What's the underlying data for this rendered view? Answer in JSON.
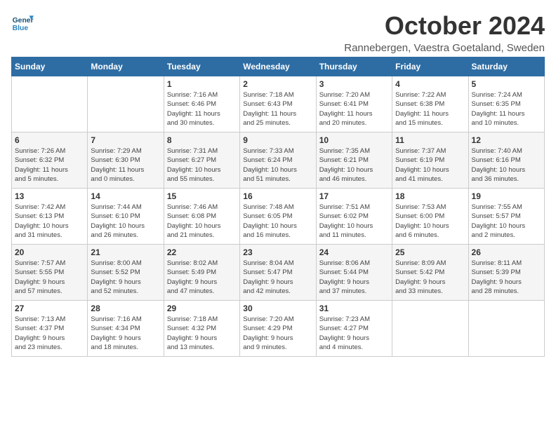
{
  "logo": {
    "general": "General",
    "blue": "Blue"
  },
  "title": "October 2024",
  "location": "Rannebergen, Vaestra Goetaland, Sweden",
  "days_header": [
    "Sunday",
    "Monday",
    "Tuesday",
    "Wednesday",
    "Thursday",
    "Friday",
    "Saturday"
  ],
  "weeks": [
    [
      {
        "day": "",
        "info": ""
      },
      {
        "day": "",
        "info": ""
      },
      {
        "day": "1",
        "info": "Sunrise: 7:16 AM\nSunset: 6:46 PM\nDaylight: 11 hours\nand 30 minutes."
      },
      {
        "day": "2",
        "info": "Sunrise: 7:18 AM\nSunset: 6:43 PM\nDaylight: 11 hours\nand 25 minutes."
      },
      {
        "day": "3",
        "info": "Sunrise: 7:20 AM\nSunset: 6:41 PM\nDaylight: 11 hours\nand 20 minutes."
      },
      {
        "day": "4",
        "info": "Sunrise: 7:22 AM\nSunset: 6:38 PM\nDaylight: 11 hours\nand 15 minutes."
      },
      {
        "day": "5",
        "info": "Sunrise: 7:24 AM\nSunset: 6:35 PM\nDaylight: 11 hours\nand 10 minutes."
      }
    ],
    [
      {
        "day": "6",
        "info": "Sunrise: 7:26 AM\nSunset: 6:32 PM\nDaylight: 11 hours\nand 5 minutes."
      },
      {
        "day": "7",
        "info": "Sunrise: 7:29 AM\nSunset: 6:30 PM\nDaylight: 11 hours\nand 0 minutes."
      },
      {
        "day": "8",
        "info": "Sunrise: 7:31 AM\nSunset: 6:27 PM\nDaylight: 10 hours\nand 55 minutes."
      },
      {
        "day": "9",
        "info": "Sunrise: 7:33 AM\nSunset: 6:24 PM\nDaylight: 10 hours\nand 51 minutes."
      },
      {
        "day": "10",
        "info": "Sunrise: 7:35 AM\nSunset: 6:21 PM\nDaylight: 10 hours\nand 46 minutes."
      },
      {
        "day": "11",
        "info": "Sunrise: 7:37 AM\nSunset: 6:19 PM\nDaylight: 10 hours\nand 41 minutes."
      },
      {
        "day": "12",
        "info": "Sunrise: 7:40 AM\nSunset: 6:16 PM\nDaylight: 10 hours\nand 36 minutes."
      }
    ],
    [
      {
        "day": "13",
        "info": "Sunrise: 7:42 AM\nSunset: 6:13 PM\nDaylight: 10 hours\nand 31 minutes."
      },
      {
        "day": "14",
        "info": "Sunrise: 7:44 AM\nSunset: 6:10 PM\nDaylight: 10 hours\nand 26 minutes."
      },
      {
        "day": "15",
        "info": "Sunrise: 7:46 AM\nSunset: 6:08 PM\nDaylight: 10 hours\nand 21 minutes."
      },
      {
        "day": "16",
        "info": "Sunrise: 7:48 AM\nSunset: 6:05 PM\nDaylight: 10 hours\nand 16 minutes."
      },
      {
        "day": "17",
        "info": "Sunrise: 7:51 AM\nSunset: 6:02 PM\nDaylight: 10 hours\nand 11 minutes."
      },
      {
        "day": "18",
        "info": "Sunrise: 7:53 AM\nSunset: 6:00 PM\nDaylight: 10 hours\nand 6 minutes."
      },
      {
        "day": "19",
        "info": "Sunrise: 7:55 AM\nSunset: 5:57 PM\nDaylight: 10 hours\nand 2 minutes."
      }
    ],
    [
      {
        "day": "20",
        "info": "Sunrise: 7:57 AM\nSunset: 5:55 PM\nDaylight: 9 hours\nand 57 minutes."
      },
      {
        "day": "21",
        "info": "Sunrise: 8:00 AM\nSunset: 5:52 PM\nDaylight: 9 hours\nand 52 minutes."
      },
      {
        "day": "22",
        "info": "Sunrise: 8:02 AM\nSunset: 5:49 PM\nDaylight: 9 hours\nand 47 minutes."
      },
      {
        "day": "23",
        "info": "Sunrise: 8:04 AM\nSunset: 5:47 PM\nDaylight: 9 hours\nand 42 minutes."
      },
      {
        "day": "24",
        "info": "Sunrise: 8:06 AM\nSunset: 5:44 PM\nDaylight: 9 hours\nand 37 minutes."
      },
      {
        "day": "25",
        "info": "Sunrise: 8:09 AM\nSunset: 5:42 PM\nDaylight: 9 hours\nand 33 minutes."
      },
      {
        "day": "26",
        "info": "Sunrise: 8:11 AM\nSunset: 5:39 PM\nDaylight: 9 hours\nand 28 minutes."
      }
    ],
    [
      {
        "day": "27",
        "info": "Sunrise: 7:13 AM\nSunset: 4:37 PM\nDaylight: 9 hours\nand 23 minutes."
      },
      {
        "day": "28",
        "info": "Sunrise: 7:16 AM\nSunset: 4:34 PM\nDaylight: 9 hours\nand 18 minutes."
      },
      {
        "day": "29",
        "info": "Sunrise: 7:18 AM\nSunset: 4:32 PM\nDaylight: 9 hours\nand 13 minutes."
      },
      {
        "day": "30",
        "info": "Sunrise: 7:20 AM\nSunset: 4:29 PM\nDaylight: 9 hours\nand 9 minutes."
      },
      {
        "day": "31",
        "info": "Sunrise: 7:23 AM\nSunset: 4:27 PM\nDaylight: 9 hours\nand 4 minutes."
      },
      {
        "day": "",
        "info": ""
      },
      {
        "day": "",
        "info": ""
      }
    ]
  ]
}
